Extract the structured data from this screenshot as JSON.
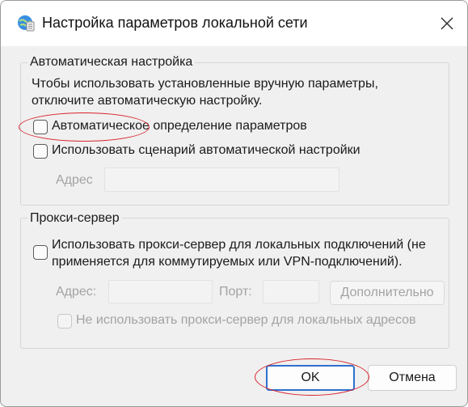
{
  "window": {
    "title": "Настройка параметров локальной сети"
  },
  "auto_config": {
    "group_label": "Автоматическая настройка",
    "description_line1": "Чтобы использовать установленные вручную параметры,",
    "description_line2": "отключите автоматическую настройку.",
    "auto_detect_label": "Автоматическое определение параметров",
    "auto_detect_checked": false,
    "use_script_label": "Использовать сценарий автоматической настройки",
    "use_script_checked": false,
    "address_label": "Адрес",
    "address_value": ""
  },
  "proxy": {
    "group_label": "Прокси-сервер",
    "use_proxy_line1": "Использовать прокси-сервер для локальных подключений (не",
    "use_proxy_line2": "применяется для коммутируемых или VPN-подключений).",
    "use_proxy_checked": false,
    "address_label": "Адрес:",
    "address_value": "",
    "port_label": "Порт:",
    "port_value": "",
    "advanced_button": "Дополнительно",
    "bypass_local_label": "Не использовать прокси-сервер для локальных адресов",
    "bypass_local_checked": false
  },
  "buttons": {
    "ok": "OK",
    "cancel": "Отмена"
  },
  "colors": {
    "annotation": "#d8232a",
    "primary_button_border": "#2f6fd0"
  },
  "icons": {
    "title": "network-settings-icon",
    "close": "close-icon"
  }
}
